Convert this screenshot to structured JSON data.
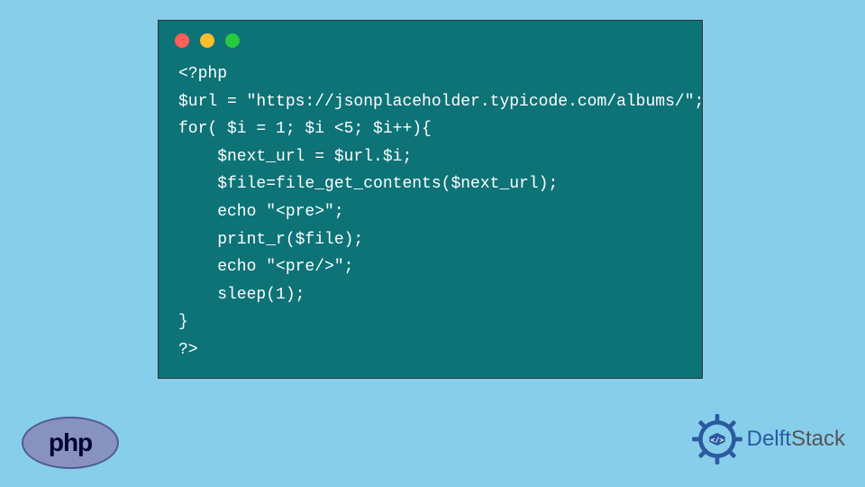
{
  "code": {
    "line1": "<?php",
    "line2": "$url = \"https://jsonplaceholder.typicode.com/albums/\";",
    "line3": "for( $i = 1; $i <5; $i++){",
    "line4": "    $next_url = $url.$i;",
    "line5": "    $file=file_get_contents($next_url);",
    "line6": "    echo \"<pre>\";",
    "line7": "    print_r($file);",
    "line8": "    echo \"<pre/>\";",
    "line9": "    sleep(1);",
    "line10": "}",
    "line11": "?>"
  },
  "logos": {
    "php": "php",
    "delft_prefix": "Delft",
    "delft_suffix": "Stack"
  }
}
